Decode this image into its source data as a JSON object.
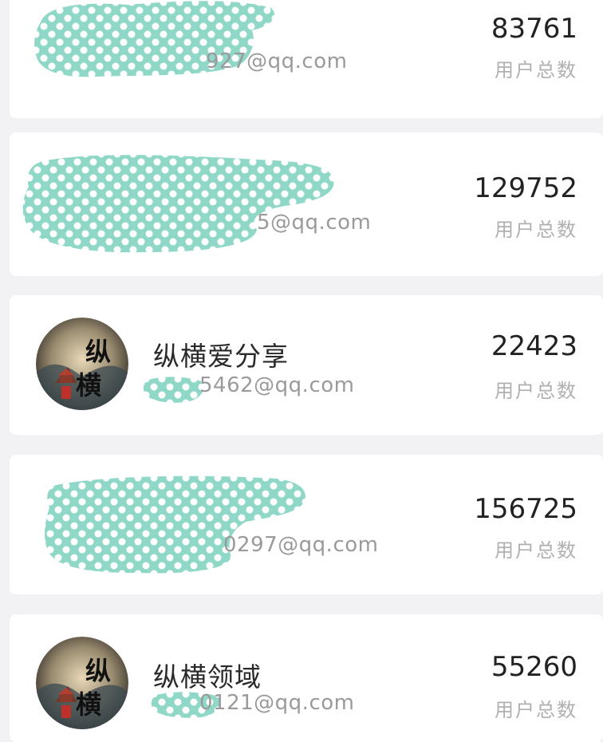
{
  "user_list": {
    "count_label": "用户总数",
    "brand_color": "#8fd8c8",
    "avatar_icon": "zongheng-logo",
    "items": [
      {
        "name": "",
        "email": "927@qq.com",
        "count": "83761",
        "has_avatar": false
      },
      {
        "name": "",
        "email": "5@qq.com",
        "count": "129752",
        "has_avatar": false
      },
      {
        "name": "纵横爱分享",
        "email": "5462@qq.com",
        "count": "22423",
        "has_avatar": true
      },
      {
        "name": "",
        "email": "0297@qq.com",
        "count": "156725",
        "has_avatar": false
      },
      {
        "name": "纵横领域",
        "email": "0121@qq.com",
        "count": "55260",
        "has_avatar": true
      }
    ]
  }
}
